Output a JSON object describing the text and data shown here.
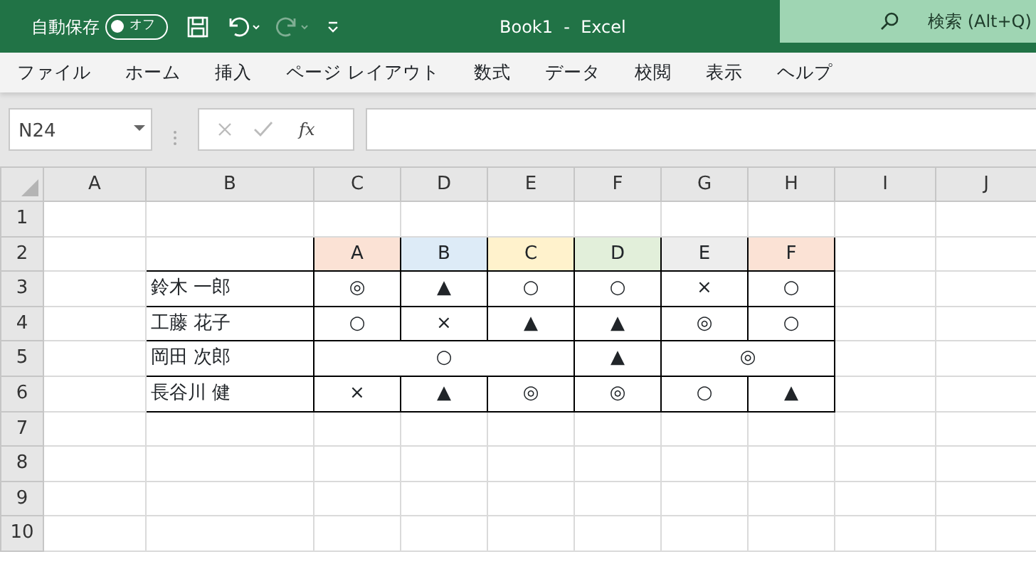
{
  "title_bar": {
    "autosave_label": "自動保存",
    "autosave_toggle": {
      "label": "オフ",
      "on": false
    },
    "redo_disabled": true,
    "title": "Book1  -  Excel",
    "search": {
      "placeholder": "検索 (Alt+Q)"
    }
  },
  "menu": [
    "ファイル",
    "ホーム",
    "挿入",
    "ページ レイアウト",
    "数式",
    "データ",
    "校閲",
    "表示",
    "ヘルプ"
  ],
  "formula_bar": {
    "name_box": "N24",
    "function_label": "fx"
  },
  "sheet": {
    "columns": [
      "A",
      "B",
      "C",
      "D",
      "E",
      "F",
      "G",
      "H",
      "I",
      "J"
    ],
    "row_numbers": [
      "1",
      "2",
      "3",
      "4",
      "5",
      "6",
      "7",
      "8",
      "9",
      "10"
    ],
    "table": {
      "header": [
        {
          "text": "A",
          "color": "#fbe2d5"
        },
        {
          "text": "B",
          "color": "#ddebf7"
        },
        {
          "text": "C",
          "color": "#fff2cc"
        },
        {
          "text": "D",
          "color": "#e2efda"
        },
        {
          "text": "E",
          "color": "#ededed"
        },
        {
          "text": "F",
          "color": "#fbe2d5"
        }
      ],
      "rows": [
        {
          "name": "鈴木 一郎",
          "cells": [
            {
              "text": "◎"
            },
            {
              "text": "▲"
            },
            {
              "text": "○"
            },
            {
              "text": "○"
            },
            {
              "text": "×"
            },
            {
              "text": "○"
            }
          ]
        },
        {
          "name": "工藤 花子",
          "cells": [
            {
              "text": "○"
            },
            {
              "text": "×"
            },
            {
              "text": "▲"
            },
            {
              "text": "▲"
            },
            {
              "text": "◎"
            },
            {
              "text": "○"
            }
          ]
        },
        {
          "name": "岡田 次郎",
          "cells": [
            {
              "text": "○",
              "colspan": 3
            },
            {
              "text": "▲"
            },
            {
              "text": "◎",
              "colspan": 2
            }
          ]
        },
        {
          "name": "長谷川 健",
          "cells": [
            {
              "text": "×"
            },
            {
              "text": "▲"
            },
            {
              "text": "◎"
            },
            {
              "text": "◎"
            },
            {
              "text": "○"
            },
            {
              "text": "▲"
            }
          ]
        }
      ]
    }
  }
}
